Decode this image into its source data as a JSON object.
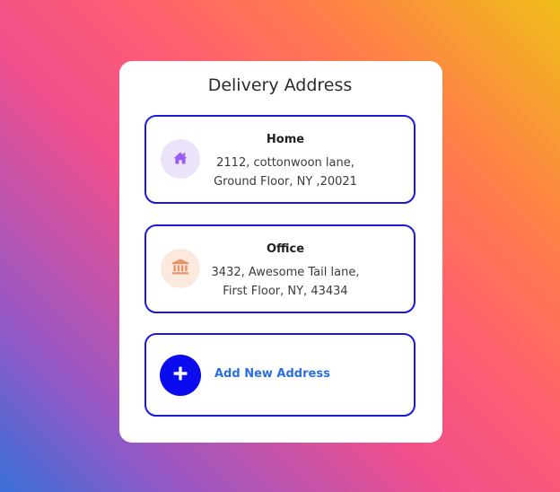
{
  "card": {
    "title": "Delivery Address"
  },
  "addresses": [
    {
      "name": "Home",
      "line1": "2112, cottonwoon lane,",
      "line2": "Ground Floor, NY ,20021",
      "icon": "home-icon",
      "icon_color": "#9a5ef0",
      "icon_bg": "#ece2fa"
    },
    {
      "name": "Office",
      "line1": "3432, Awesome Tail lane,",
      "line2": "First Floor, NY, 43434",
      "icon": "bank-building-icon",
      "icon_color": "#e9936a",
      "icon_bg": "#fbe9de"
    }
  ],
  "add_address": {
    "label": "Add New Address",
    "icon": "plus-icon",
    "icon_bg": "#0b0bf0",
    "label_color": "#2a6fe0"
  },
  "colors": {
    "box_border": "#1a1ad6",
    "gradient": [
      "#3a6fd8",
      "#9a57c4",
      "#ef4f8c",
      "#ff5d73",
      "#ff8146",
      "#f0be1a"
    ]
  }
}
